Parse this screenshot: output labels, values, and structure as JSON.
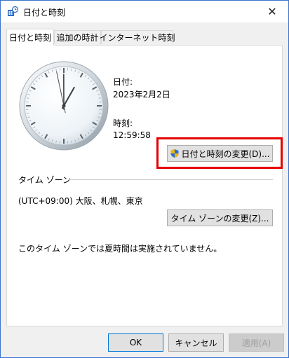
{
  "window": {
    "title": "日付と時刻",
    "close_glyph": "✕"
  },
  "tabs": [
    {
      "label": "日付と時刻",
      "active": true
    },
    {
      "label": "追加の時計",
      "active": false
    },
    {
      "label": "インターネット時刻",
      "active": false
    }
  ],
  "date_section": {
    "date_label": "日付:",
    "date_value": "2023年2月2日",
    "time_label": "時刻:",
    "time_value": "12:59:58"
  },
  "clock": {
    "hours": 12,
    "minutes": 59,
    "seconds": 58
  },
  "change_datetime_button": "日付と時刻の変更(D)...",
  "timezone": {
    "section_title": "タイム ゾーン",
    "value": "(UTC+09:00) 大阪、札幌、東京",
    "change_button": "タイム ゾーンの変更(Z)..."
  },
  "dst_note": "このタイム ゾーンでは夏時間は実施されていません。",
  "footer": {
    "ok": "OK",
    "cancel": "キャンセル",
    "apply": "適用(A)"
  },
  "colors": {
    "highlight": "#e60000",
    "accent": "#0078d7"
  }
}
